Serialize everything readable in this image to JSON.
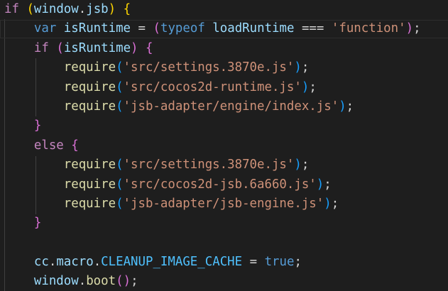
{
  "editor": {
    "language": "javascript",
    "theme": "dark",
    "background": "#1e1e1e",
    "lines": [
      "if (window.jsb) {",
      "    var isRuntime = (typeof loadRuntime === 'function');",
      "    if (isRuntime) {",
      "        require('src/settings.3870e.js');",
      "        require('src/cocos2d-runtime.js');",
      "        require('jsb-adapter/engine/index.js');",
      "    }",
      "    else {",
      "        require('src/settings.3870e.js');",
      "        require('src/cocos2d-jsb.6a660.js');",
      "        require('jsb-adapter/jsb-engine.js');",
      "    }",
      "",
      "    cc.macro.CLEANUP_IMAGE_CACHE = true;",
      "    window.boot();"
    ]
  },
  "syntax_colors": {
    "control_keyword": "#c586c0",
    "storage_keyword": "#569cd6",
    "variable": "#9cdcfe",
    "function": "#dcdcaa",
    "string": "#ce9178",
    "constant": "#4fc1ff",
    "punctuation": "#d4d4d4",
    "bracket_level_1": "#ffd700",
    "bracket_level_2": "#da70d6",
    "bracket_level_3": "#179fff"
  }
}
